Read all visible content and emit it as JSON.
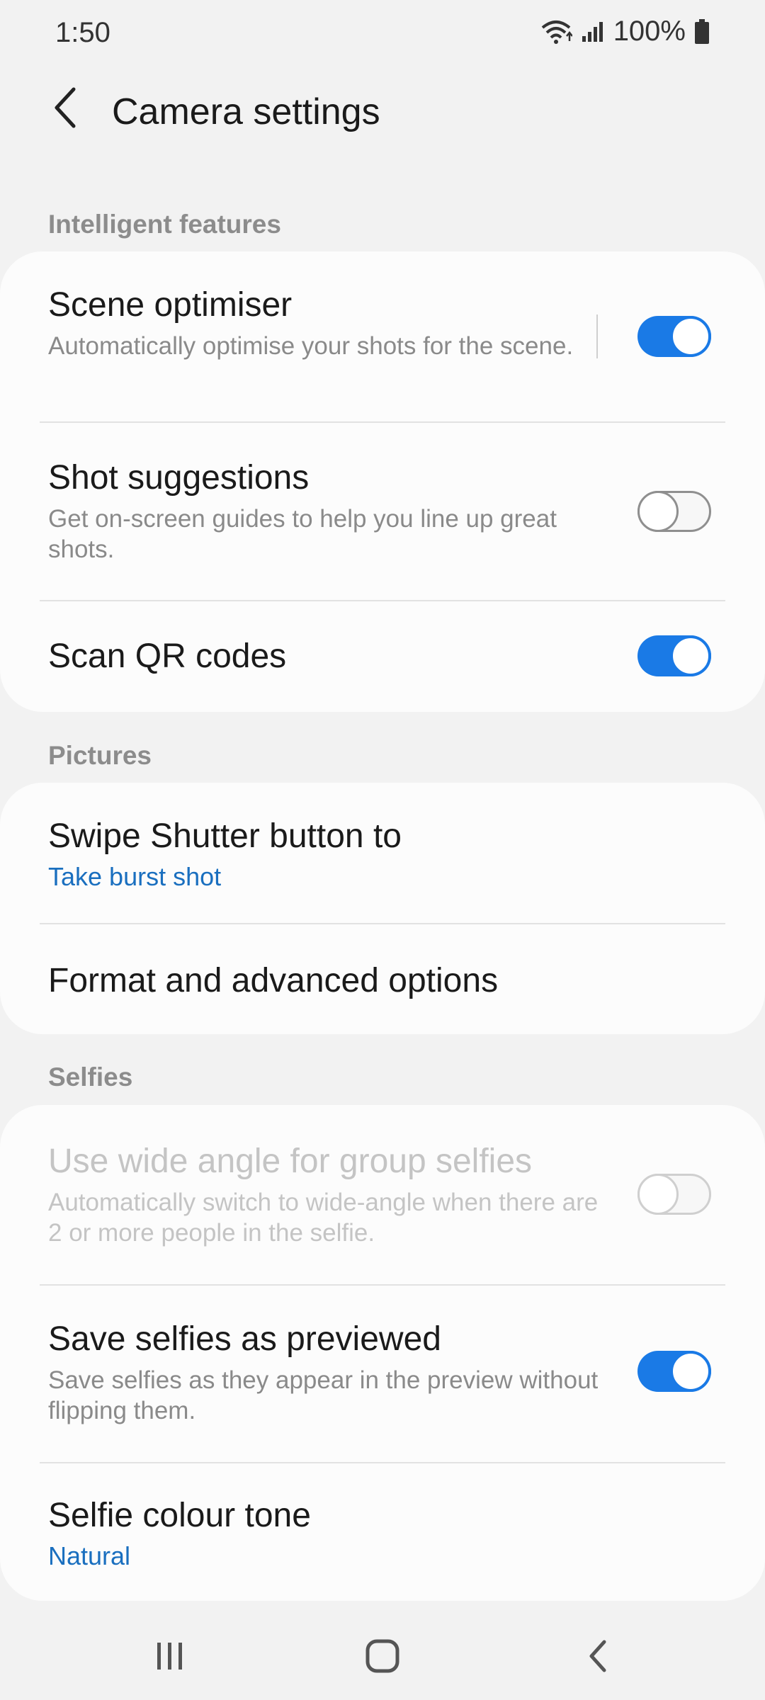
{
  "status_bar": {
    "time": "1:50",
    "battery": "100%",
    "icons": [
      "wifi-icon",
      "signal-icon",
      "battery-icon"
    ]
  },
  "header": {
    "title": "Camera settings",
    "back_icon": "back-arrow-icon"
  },
  "sections": {
    "intelligent": {
      "header": "Intelligent features",
      "scene_optimiser": {
        "title": "Scene optimiser",
        "subtitle": "Automatically optimise your shots for the scene.",
        "enabled": true
      },
      "shot_suggestions": {
        "title": "Shot suggestions",
        "subtitle": "Get on-screen guides to help you line up great shots.",
        "enabled": false
      },
      "scan_qr": {
        "title": "Scan QR codes",
        "enabled": true
      }
    },
    "pictures": {
      "header": "Pictures",
      "swipe_shutter": {
        "title": "Swipe Shutter button to",
        "value": "Take burst shot"
      },
      "format_options": {
        "title": "Format and advanced options"
      }
    },
    "selfies": {
      "header": "Selfies",
      "wide_angle": {
        "title": "Use wide angle for group selfies",
        "subtitle": "Automatically switch to wide-angle when there are 2 or more people in the selfie.",
        "enabled": false,
        "disabled": true
      },
      "save_previewed": {
        "title": "Save selfies as previewed",
        "subtitle": "Save selfies as they appear in the preview without flipping them.",
        "enabled": true
      },
      "colour_tone": {
        "title": "Selfie colour tone",
        "value": "Natural"
      }
    }
  },
  "nav_bar": {
    "icons": [
      "recent-apps-icon",
      "home-icon",
      "back-icon"
    ]
  },
  "colors": {
    "accent": "#1a7ae6",
    "link": "#1a6fbf",
    "background": "#f2f2f2",
    "card": "#fcfcfc"
  }
}
